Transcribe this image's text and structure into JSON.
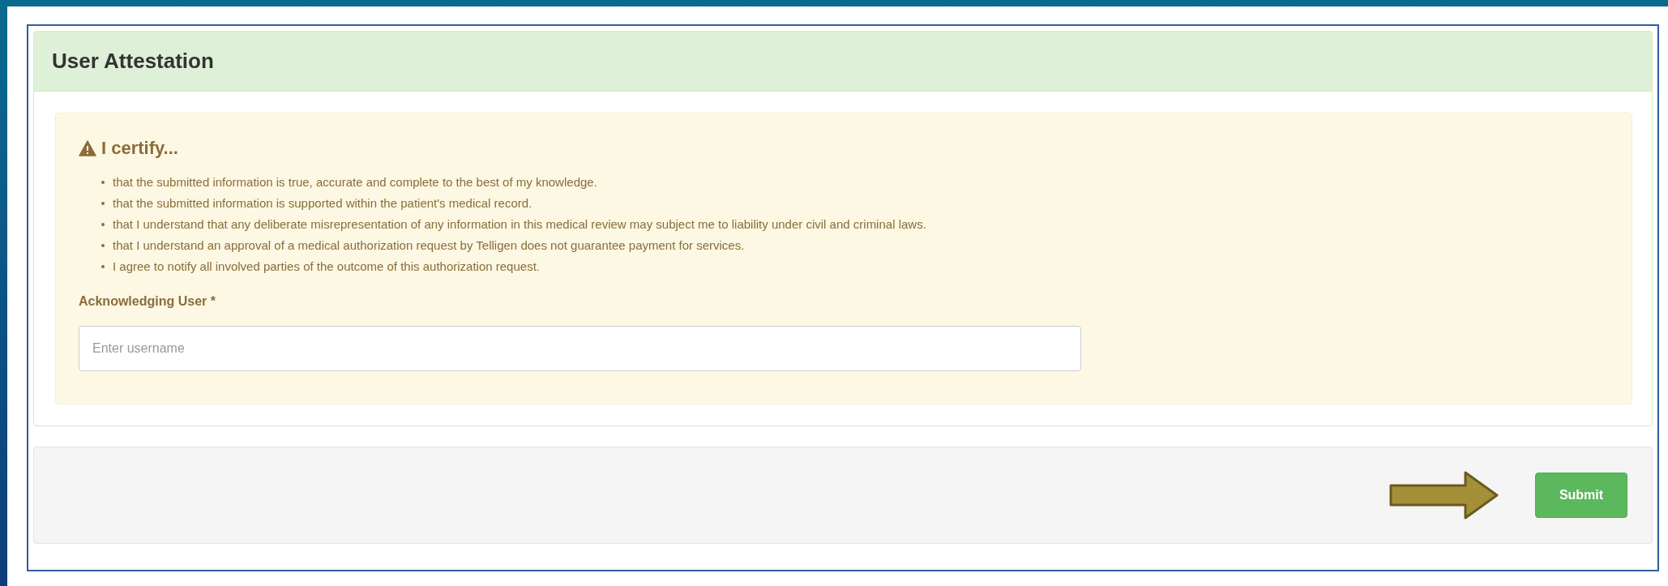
{
  "panel": {
    "title": "User Attestation"
  },
  "alert": {
    "heading": "I certify...",
    "items": [
      "that the submitted information is true, accurate and complete to the best of my knowledge.",
      "that the submitted information is supported within the patient's medical record.",
      "that I understand that any deliberate misrepresentation of any information in this medical review may subject me to liability under civil and criminal laws.",
      "that I understand an approval of a medical authorization request by Telligen does not guarantee payment for services.",
      "I agree to notify all involved parties of the outcome of this authorization request."
    ]
  },
  "field": {
    "label": "Acknowledging User *",
    "placeholder": "Enter username"
  },
  "footer": {
    "buttons": [
      "Submit"
    ]
  }
}
